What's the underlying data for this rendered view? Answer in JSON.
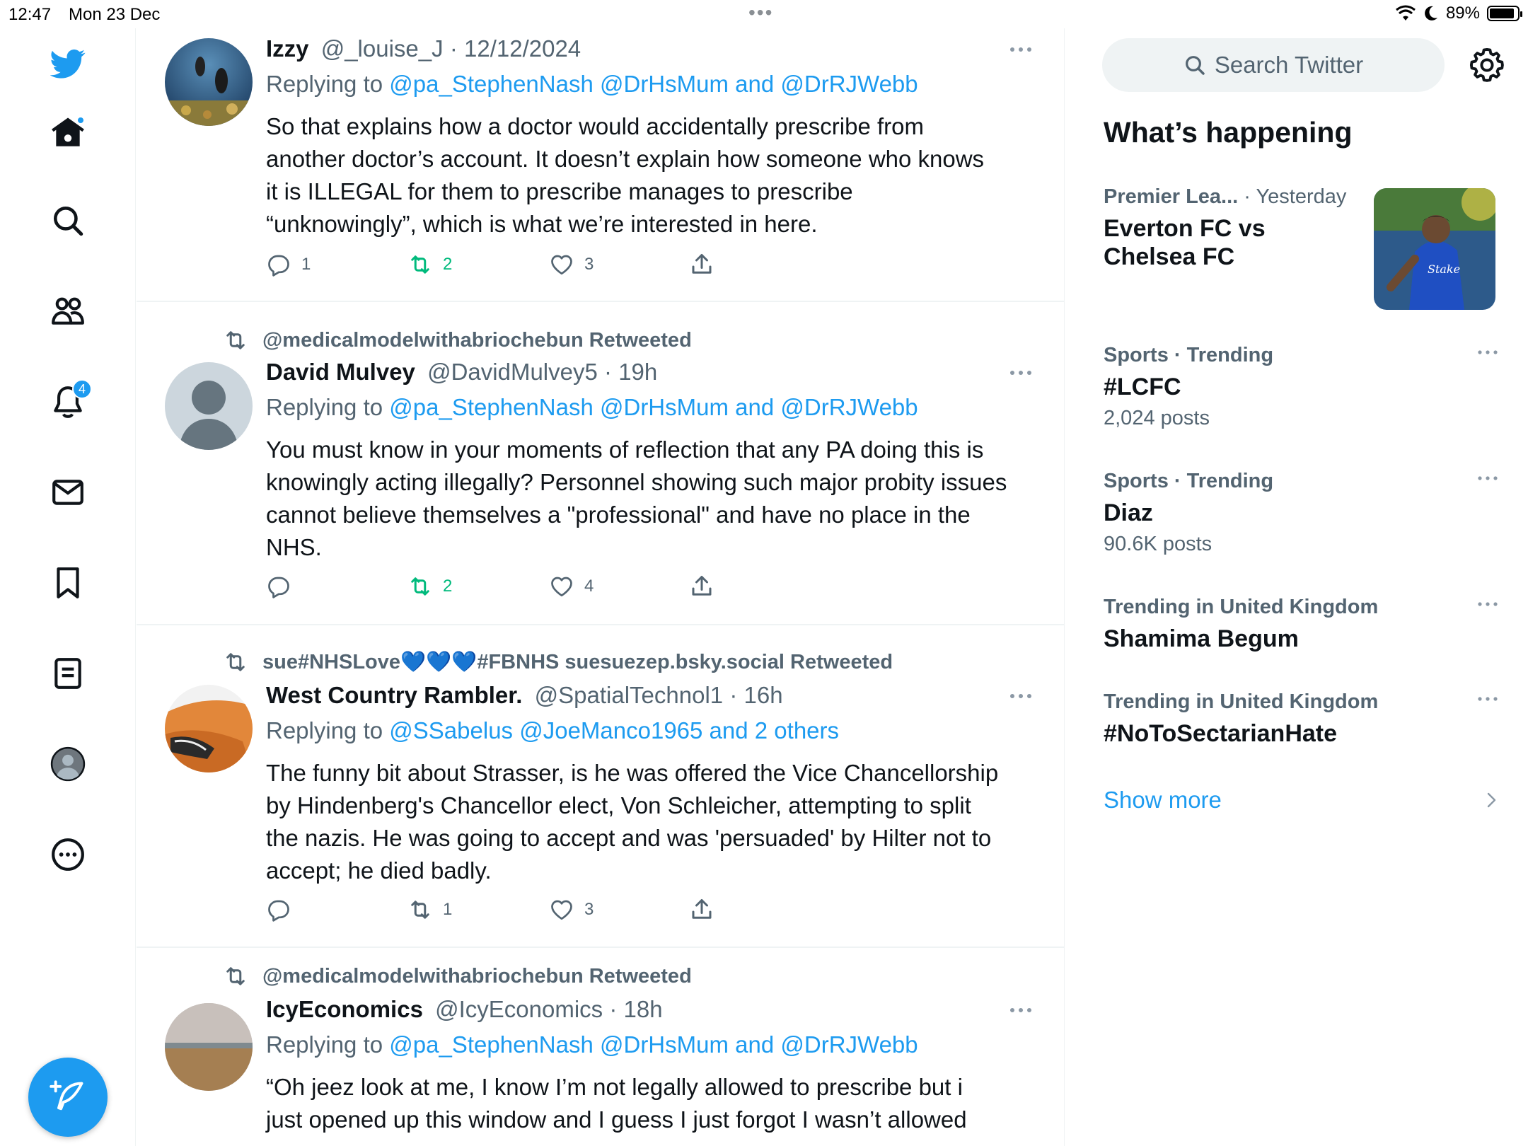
{
  "status_bar": {
    "time": "12:47",
    "date": "Mon 23 Dec",
    "battery": "89%"
  },
  "nav": {
    "items": [
      {
        "icon": "twitter-bird-icon"
      },
      {
        "icon": "home-icon"
      },
      {
        "icon": "search-icon"
      },
      {
        "icon": "communities-icon"
      },
      {
        "icon": "notifications-icon",
        "badge": "4"
      },
      {
        "icon": "messages-icon"
      },
      {
        "icon": "bookmarks-icon"
      },
      {
        "icon": "lists-icon"
      },
      {
        "icon": "profile-icon"
      },
      {
        "icon": "more-icon"
      }
    ],
    "compose_icon": "compose-tweet-icon",
    "accent": "#1d9bf0"
  },
  "timeline": {
    "tweets": [
      {
        "retweeted_by": "",
        "name": "Izzy",
        "handle": "@_louise_J",
        "time": "12/12/2024",
        "replying_prefix": "Replying to",
        "mentions": "@pa_StephenNash @DrHsMum and @DrRJWebb",
        "text_lines": [
          "So that explains how a doctor would accidentally prescribe from",
          "another doctor’s account. It doesn’t explain how someone who knows",
          "it is ILLEGAL for them to prescribe  manages to prescribe",
          "“unknowingly”, which is what we’re interested in here."
        ],
        "replies": "1",
        "retweets": "2",
        "likes": "3"
      },
      {
        "retweeted_by": "@medicalmodelwithabriochebun Retweeted",
        "name": "David Mulvey",
        "handle": "@DavidMulvey5",
        "time": "19h",
        "replying_prefix": "Replying to",
        "mentions": "@pa_StephenNash @DrHsMum and @DrRJWebb",
        "text_lines": [
          "You must know in your moments of reflection that any PA doing this is",
          "knowingly acting illegally? Personnel showing such major probity issues",
          "cannot believe themselves a \"professional\" and have no place in the",
          "NHS."
        ],
        "replies": "",
        "retweets": "2",
        "likes": "4"
      },
      {
        "retweeted_by": "sue#NHSLove💙💙💙#FBNHS suesuezep.bsky.social Retweeted",
        "name": "West Country Rambler.",
        "handle": "@SpatialTechnol1",
        "time": "16h",
        "replying_prefix": "Replying to",
        "mentions": "@SSabelus @JoeManco1965 and 2 others",
        "text_lines": [
          "The funny bit about Strasser, is he was offered the Vice Chancellorship",
          "by Hindenberg's Chancellor elect, Von Schleicher, attempting to split",
          "the nazis.  He was going to accept and was 'persuaded' by Hilter not to",
          "accept; he died badly."
        ],
        "replies": "",
        "retweets": "1",
        "likes": "3"
      },
      {
        "retweeted_by": "@medicalmodelwithabriochebun Retweeted",
        "name": "IcyEconomics",
        "handle": "@IcyEconomics",
        "time": "18h",
        "replying_prefix": "Replying to",
        "mentions": "@pa_StephenNash @DrHsMum and @DrRJWebb",
        "text_lines": [
          "“Oh jeez look at me, I know I’m not legally allowed to prescribe but i",
          "just opened up this window and I guess I just forgot I wasn’t allowed"
        ],
        "replies": "",
        "retweets": "",
        "likes": ""
      }
    ]
  },
  "sidebar": {
    "search_placeholder": "Search Twitter",
    "whats_happening": "What’s happening",
    "news": {
      "category": "Premier Lea...",
      "time": "· Yesterday",
      "line1": "Everton FC vs",
      "line2": "Chelsea FC"
    },
    "trends": [
      {
        "context": "Sports · Trending",
        "topic": "#LCFC",
        "count": "2,024 posts"
      },
      {
        "context": "Sports · Trending",
        "topic": "Diaz",
        "count": "90.6K posts"
      },
      {
        "context": "Trending in United Kingdom",
        "topic": "Shamima Begum",
        "count": ""
      },
      {
        "context": "Trending in United Kingdom",
        "topic": "#NoToSectarianHate",
        "count": ""
      }
    ],
    "show_more": "Show more"
  }
}
